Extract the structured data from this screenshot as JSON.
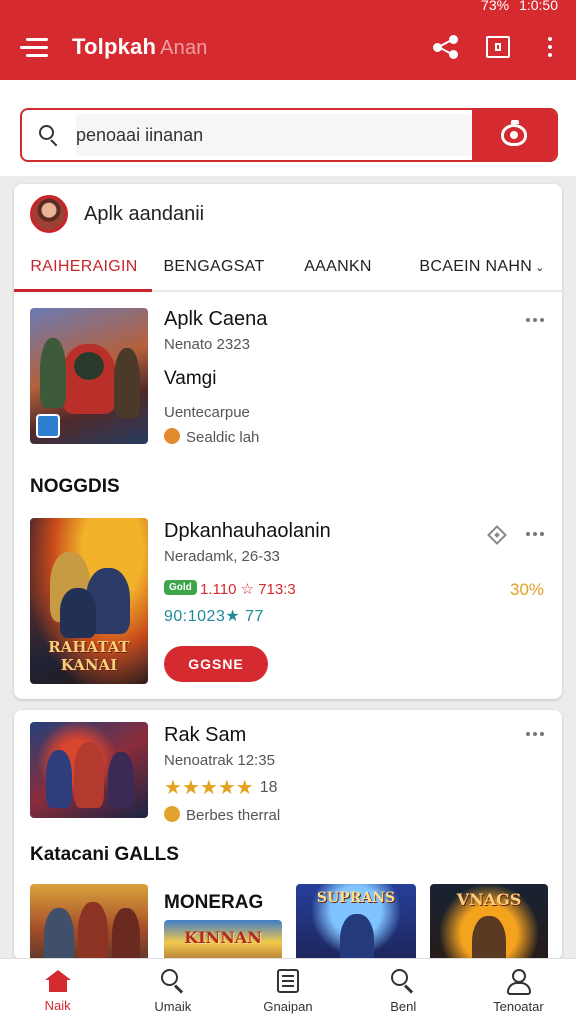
{
  "status": {
    "time": "1:0:50",
    "battery": "73%"
  },
  "appbar": {
    "title": "Tolpkah",
    "subtitle": "Anan"
  },
  "search": {
    "value": "penoaai iinanan"
  },
  "profile": {
    "name": "Aplk aandanii"
  },
  "tabs": [
    "RAIHERAIGIN",
    "BENGAGSAT",
    "AAANKN",
    "BCAEIN NAHN"
  ],
  "items": [
    {
      "title": "Aplk Caena",
      "date": "Nenato 2323",
      "line": "Vamgi",
      "small": "Uentecarpue",
      "meta": "Sealdic lah"
    },
    {
      "title": "Dpkanhauhaolanin",
      "date": "Neradamk, 26-33",
      "badge": "Gold",
      "red": "1.110 ☆ 713:3",
      "teal": "90:1023★ 77",
      "pct": "30%",
      "button": "GGSNE",
      "bannertxt": "RAHATAT KANAI"
    },
    {
      "title": "Rak Sam",
      "date": "Nenoatrak 12:35",
      "rating": "18",
      "meta": "Berbes therral"
    }
  ],
  "sections": {
    "first": "NOGGDIS",
    "second": "Katacani GALLS",
    "mini_title": "MONERAG",
    "mini_banner": "KINNAN",
    "thumb6_txt": "SUPRANS",
    "thumb7_txt": "VNAGS"
  },
  "nav": [
    "Naik",
    "Umaik",
    "Gnaipan",
    "Benl",
    "Tenoatar"
  ],
  "colors": {
    "brand": "#d52a2f",
    "accent": "#e0a020",
    "teal": "#1f8a9a"
  }
}
